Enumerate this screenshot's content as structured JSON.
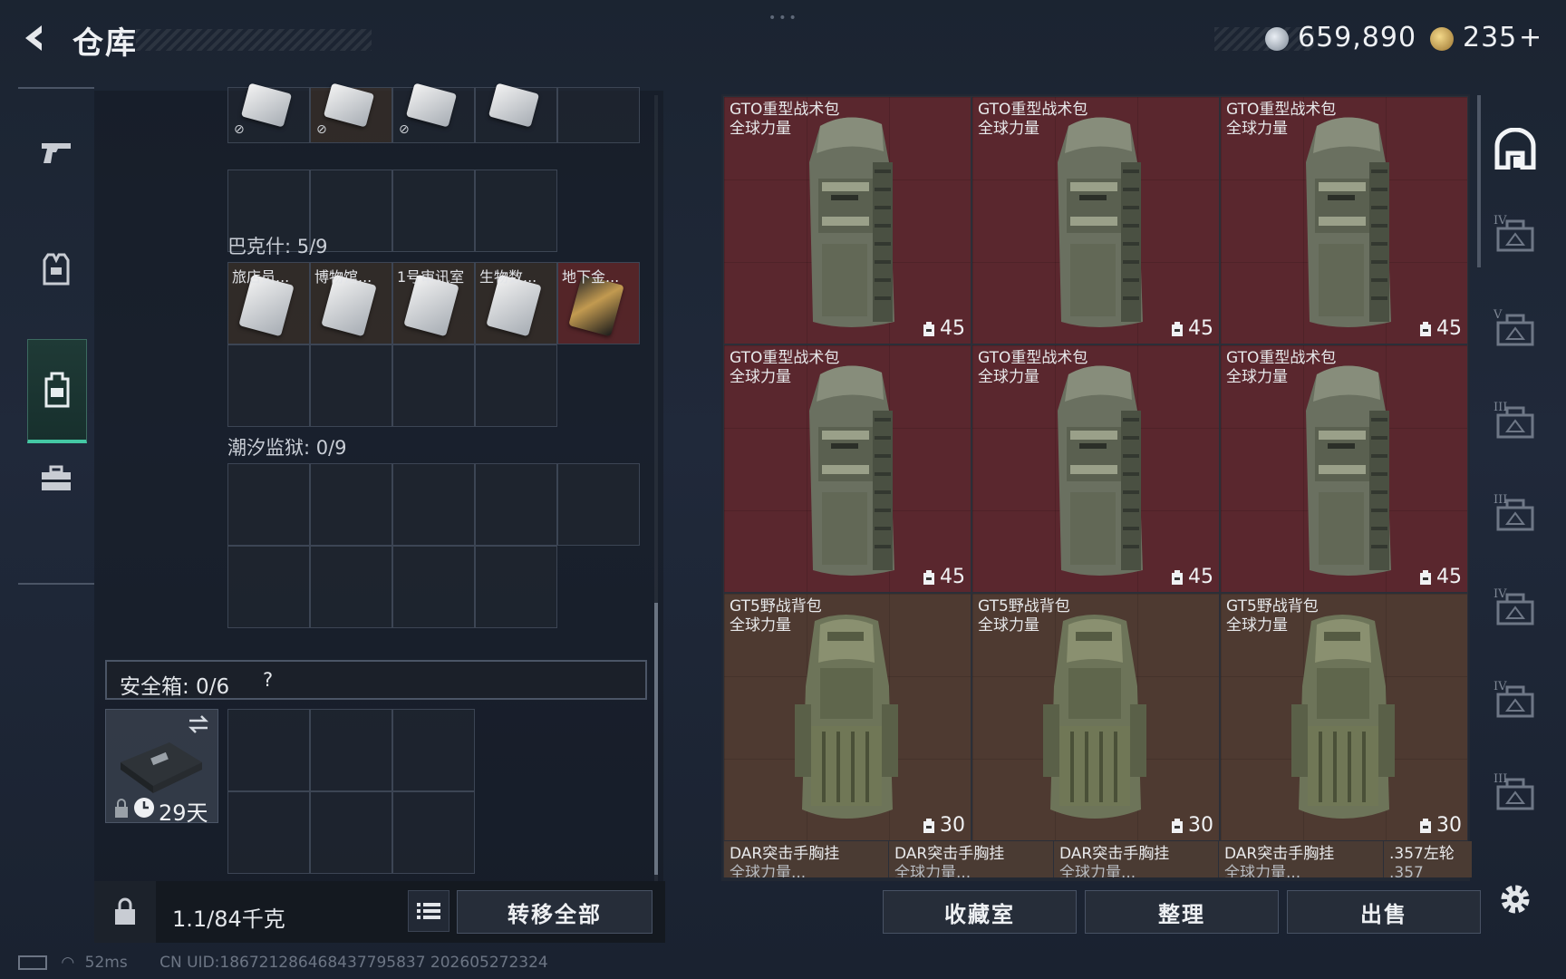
{
  "header": {
    "back_label": "<",
    "title": "仓库",
    "silver_amount": "659,890",
    "gold_amount": "235",
    "gold_plus": "+",
    "dots": "•••"
  },
  "left_sidebar": {
    "items": [
      {
        "icon": "pistol-icon",
        "active": false
      },
      {
        "icon": "vest-icon",
        "active": false
      },
      {
        "icon": "backpack-icon",
        "active": true
      },
      {
        "icon": "toolbox-icon",
        "active": false
      }
    ]
  },
  "storage": {
    "top_rows": {
      "cards": [
        {
          "label": ""
        },
        {
          "label": ""
        },
        {
          "label": ""
        },
        {
          "label": ""
        }
      ]
    },
    "bakshi": {
      "label": "巴克什: 5/9",
      "cards": [
        {
          "label": "旅店员..."
        },
        {
          "label": "博物馆..."
        },
        {
          "label": "1号审讯室"
        },
        {
          "label": "生物数..."
        },
        {
          "label": "地下金..."
        }
      ]
    },
    "tidal": {
      "label": "潮汐监狱: 0/9"
    },
    "safe": {
      "label": "安全箱: 0/6",
      "help": "?",
      "days": "29天"
    },
    "weight": "1.1/84千克",
    "transfer_all": "转移全部"
  },
  "items": [
    {
      "name": "GTO重型战术包",
      "sub": "全球力量",
      "capacity": "45",
      "style": "red"
    },
    {
      "name": "GTO重型战术包",
      "sub": "全球力量",
      "capacity": "45",
      "style": "red"
    },
    {
      "name": "GTO重型战术包",
      "sub": "全球力量",
      "capacity": "45",
      "style": "red"
    },
    {
      "name": "GTO重型战术包",
      "sub": "全球力量",
      "capacity": "45",
      "style": "red"
    },
    {
      "name": "GTO重型战术包",
      "sub": "全球力量",
      "capacity": "45",
      "style": "red"
    },
    {
      "name": "GTO重型战术包",
      "sub": "全球力量",
      "capacity": "45",
      "style": "red"
    },
    {
      "name": "GT5野战背包",
      "sub": "全球力量",
      "capacity": "30",
      "style": "brown"
    },
    {
      "name": "GT5野战背包",
      "sub": "全球力量",
      "capacity": "30",
      "style": "brown"
    },
    {
      "name": "GT5野战背包",
      "sub": "全球力量",
      "capacity": "30",
      "style": "brown"
    }
  ],
  "partial_items": [
    {
      "name": "DAR突击手胸挂",
      "sub": "全球力量..."
    },
    {
      "name": "DAR突击手胸挂",
      "sub": "全球力量..."
    },
    {
      "name": "DAR突击手胸挂",
      "sub": "全球力量..."
    },
    {
      "name": "DAR突击手胸挂",
      "sub": "全球力量..."
    },
    {
      "name": ".357左轮",
      "sub": ".357"
    }
  ],
  "actions": {
    "collection": "收藏室",
    "organize": "整理",
    "sell": "出售"
  },
  "right_tabs": [
    {
      "icon": "armory-icon",
      "tier": ""
    },
    {
      "icon": "folder-case-icon",
      "tier": "IV"
    },
    {
      "icon": "safe-box-icon",
      "tier": "V"
    },
    {
      "icon": "warning-box-icon",
      "tier": "III"
    },
    {
      "icon": "warning-box-icon",
      "tier": "III"
    },
    {
      "icon": "medkit-icon",
      "tier": "IV"
    },
    {
      "icon": "crate-icon",
      "tier": "IV"
    },
    {
      "icon": "rifle-box-icon",
      "tier": "III"
    }
  ],
  "footer": {
    "ping": "52ms",
    "uid": "CN UID:1867212864684377958​37 202605272324"
  },
  "colors": {
    "accent": "#44c8a4",
    "red_cell": "#5a272e",
    "brown_cell": "#4e3a31"
  }
}
